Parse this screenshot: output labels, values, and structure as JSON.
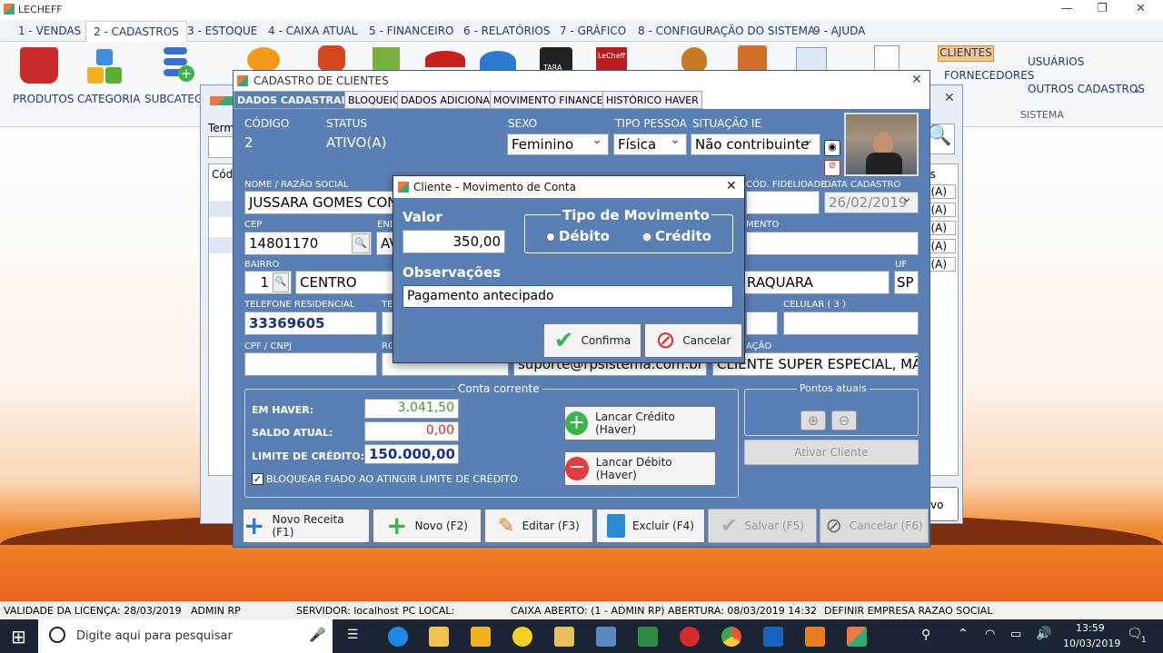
{
  "app": {
    "title": "LECHEFF"
  },
  "menu": [
    "1 - VENDAS",
    "2 - CADASTROS",
    "3 - ESTOQUE",
    "4 - CAIXA ATUAL",
    "5 - FINANCEIRO",
    "6 - RELATÓRIOS",
    "7 - GRÁFICO",
    "8 - CONFIGURAÇÃO DO SISTEMA",
    "9 - AJUDA"
  ],
  "ribbon": {
    "produtos": "PRODUTOS",
    "categoria": "CATEGORIA",
    "subcategoria": "SUBCATEGO",
    "clientes": "CLIENTES",
    "fornecedores": "FORNECEDORES",
    "usuarios": "USUÁRIOS",
    "outros": "OUTROS CADASTROS",
    "sistema": "SISTEMA",
    "tara": "TARA",
    "lecheff": "LeCheff"
  },
  "back": {
    "term": "Term",
    "cod": "Códi",
    "us": "us",
    "rows": [
      "O(A)",
      "O(A)",
      "O(A)",
      "O(A)",
      "O(A)"
    ],
    "vo": "vo"
  },
  "cadastro": {
    "title": "CADASTRO DE CLIENTES",
    "tabs": [
      "DADOS CADASTRAIS",
      "BLOQUEIO",
      "DADOS ADICIONAIS",
      "MOVIMENTO FINANCEIRO",
      "HISTÓRICO HAVER"
    ],
    "codigo_label": "CÓDIGO",
    "codigo": "2",
    "status_label": "STATUS",
    "status": "ATIVO(A)",
    "sexo_label": "SEXO",
    "sexo": "Feminino",
    "tipo_label": "TIPO PESSOA",
    "tipo": "Física",
    "ie_label": "SITUAÇÃO IE",
    "ie": "Não contribuinte",
    "nome_label": "NOME / RAZÃO SOCIAL",
    "nome": "JUSSARA GOMES CONC",
    "fidel_label": "CÓD. FIDELIDADE",
    "data_label": "DATA CADASTRO",
    "data": "26/02/2019",
    "cep_label": "CEP",
    "cep": "14801170",
    "end_label": "END",
    "end": "AV",
    "compl_label": "MENTO",
    "bairro_label": "BAIRRO",
    "bairro_num": "1",
    "bairro": "CENTRO",
    "cidade": "RAQUARA",
    "uf_label": "UF",
    "uf": "SP",
    "tel_label": "TELEFONE RESIDENCIAL",
    "tel": "33369605",
    "tel2_label": "TE",
    "cel_label": "CELULAR ( 3 )",
    "cpf_label": "CPF / CNPJ",
    "rg_label": "RG",
    "email": "suporte@rpsistema.com.br",
    "obs_label": "AÇÃO",
    "obs": "CLIENTE SUPER ESPECIAL, MÃE",
    "conta_title": "Conta corrente",
    "haver_label": "EM HAVER:",
    "haver": "3.041,50",
    "saldo_label": "SALDO ATUAL:",
    "saldo": "0,00",
    "limite_label": "LIMITE DE CRÉDITO:",
    "limite": "150.000,00",
    "bloquear": "BLOQUEAR FIADO AO ATINGIR LIMITE DE CRÉDITO",
    "lanc_credito": "Lancar Crédito (Haver)",
    "lanc_debito": "Lancar Débito (Haver)",
    "pontos_title": "Pontos atuais",
    "ativar": "Ativar Cliente",
    "btn_novo_receita": "Novo Receita (F1)",
    "btn_novo": "Novo (F2)",
    "btn_editar": "Editar (F3)",
    "btn_excluir": "Excluir (F4)",
    "btn_salvar": "Salvar (F5)",
    "btn_cancelar": "Cancelar (F6)"
  },
  "dialog": {
    "title": "Cliente - Movimento de Conta",
    "valor_label": "Valor",
    "valor": "350,00",
    "tipo_title": "Tipo de Movimento",
    "debito": "Débito",
    "credito": "Crédito",
    "obs_label": "Observações",
    "obs": "Pagamento antecipado",
    "confirma": "Confirma",
    "cancelar": "Cancelar"
  },
  "statusbar": {
    "licenca": "VALIDADE DA LICENÇA: 28/03/2019",
    "user": "ADMIN RP",
    "servidor": "SERVIDOR: localhost",
    "pc": "PC LOCAL:",
    "caixa": "CAIXA ABERTO: (1 - ADMIN RP) ABERTURA: 08/03/2019 14:32",
    "empresa": "DEFINIR EMPRESA RAZAO SOCIAL"
  },
  "taskbar": {
    "search": "Digite aqui para pesquisar",
    "time": "13:59",
    "date": "10/03/2019",
    "notif": "1"
  }
}
